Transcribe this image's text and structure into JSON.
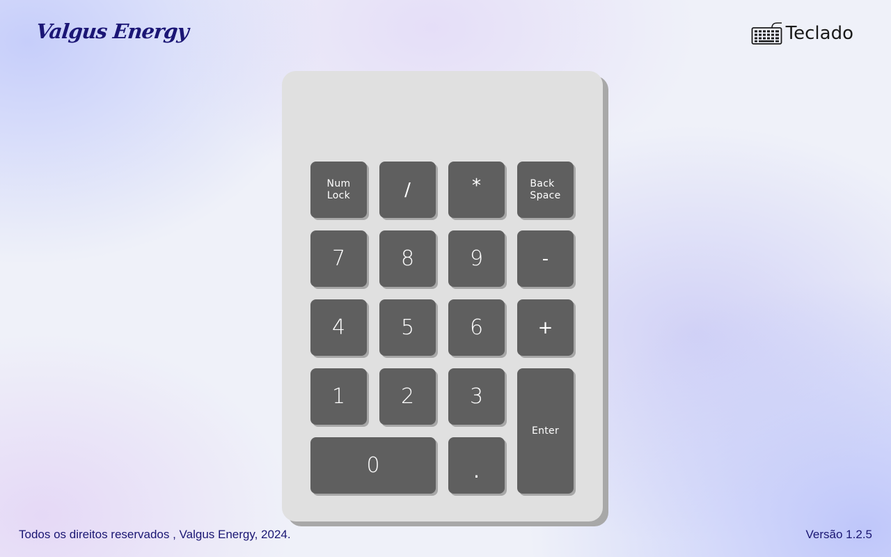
{
  "brand": {
    "name": "Valgus Energy",
    "color": "#1b1675"
  },
  "header": {
    "title": "Teclado",
    "icon": "keyboard-icon"
  },
  "keypad": {
    "keys": {
      "numlock": "Num\nLock",
      "divide": "/",
      "multiply": "*",
      "backspace": "Back\nSpace",
      "seven": "7",
      "eight": "8",
      "nine": "9",
      "minus": "-",
      "four": "4",
      "five": "5",
      "six": "6",
      "plus": "+",
      "one": "1",
      "two": "2",
      "three": "3",
      "enter": "Enter",
      "zero": "0",
      "decimal": "."
    },
    "colors": {
      "body": "#e0e0e0",
      "key": "#5f5f5f",
      "key_text": "#ffffff"
    }
  },
  "footer": {
    "copyright": "Todos os direitos reservados , Valgus Energy, 2024.",
    "version": "Versão 1.2.5"
  }
}
